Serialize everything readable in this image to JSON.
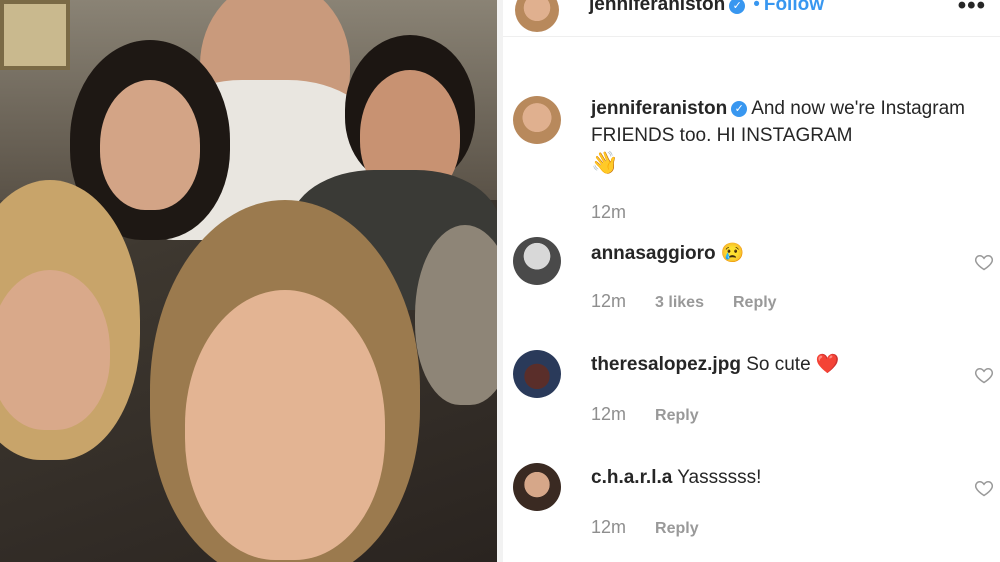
{
  "post": {
    "username": "jenniferaniston",
    "follow_label": "Follow",
    "separator": "•",
    "more_label": "•••",
    "caption": "And now we're Instagram FRIENDS too. HI INSTAGRAM",
    "caption_emoji": "👋",
    "time": "12m"
  },
  "comments": [
    {
      "username": "annasaggioro",
      "text": "",
      "emoji": "😢",
      "time": "12m",
      "likes": "3 likes",
      "reply": "Reply"
    },
    {
      "username": "theresalopez.jpg",
      "text": "So cute",
      "emoji": "❤️",
      "time": "12m",
      "likes": "",
      "reply": "Reply"
    },
    {
      "username": "c.h.a.r.l.a",
      "text": "Yassssss!",
      "emoji": "",
      "time": "12m",
      "likes": "",
      "reply": "Reply"
    }
  ],
  "colors": {
    "link": "#3897f0",
    "muted": "#8e8e8e",
    "text": "#262626"
  },
  "icons": [
    "verified-badge-icon",
    "more-options-icon",
    "heart-outline-icon"
  ]
}
